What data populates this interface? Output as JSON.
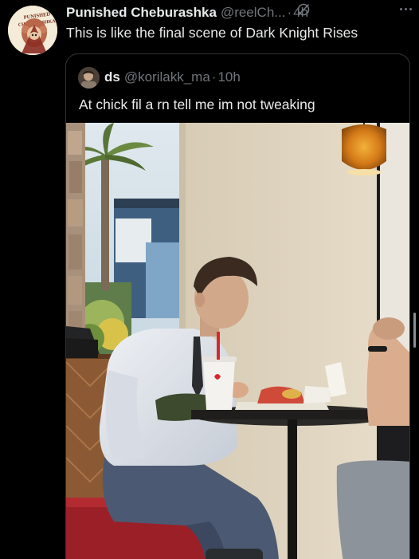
{
  "post": {
    "display_name": "Punished Cheburashka",
    "handle": "@reelCh...",
    "separator": "·",
    "time": "4h",
    "text": "This is like the final scene of Dark Knight Rises",
    "avatar_text": [
      "PUNISHED",
      "CHEBURASHKA"
    ],
    "grok_icon": "slash-circle-icon",
    "more_icon": "more-horizontal-icon"
  },
  "quote": {
    "display_name": "ds",
    "handle": "@korilakk_ma",
    "separator": "·",
    "time": "10h",
    "text": "At chick fil a rn tell me im not tweaking",
    "photo": "man praying over meal at restaurant table"
  },
  "colors": {
    "background": "#000000",
    "text_primary": "#e7e9ea",
    "text_secondary": "#71767b",
    "border": "#2f3336"
  }
}
